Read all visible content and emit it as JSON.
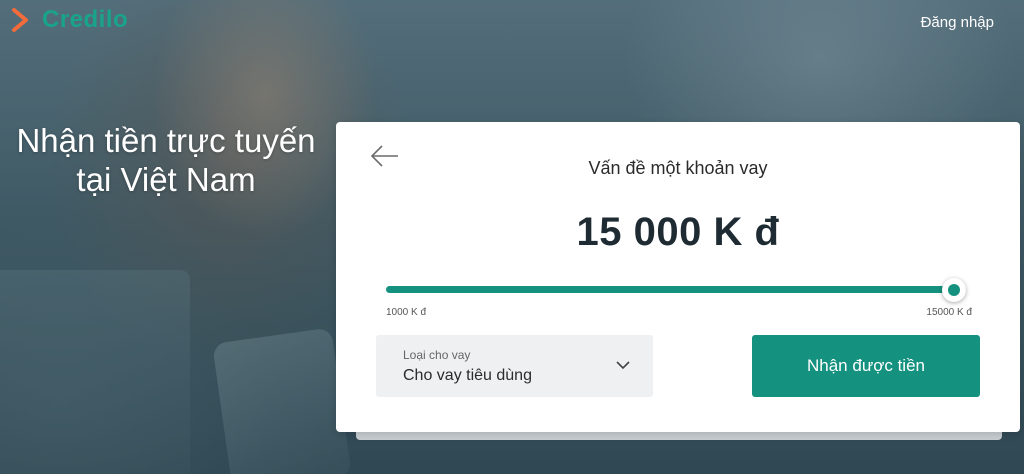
{
  "brand": {
    "name": "Credilo",
    "accent": "#1aa38c",
    "chevron_color": "#f26b3a",
    "button_color": "#15917f"
  },
  "header": {
    "login_label": "Đăng nhập"
  },
  "hero": {
    "title_line1": "Nhận tiền trực tuyến",
    "title_line2": "tại Việt Nam"
  },
  "card": {
    "back_icon": "arrow-left-icon",
    "title": "Vấn đề một khoản vay",
    "amount": "15 000 K đ",
    "slider": {
      "min_label": "1000 K đ",
      "max_label": "15000 K đ",
      "min": 1000,
      "max": 15000,
      "value": 15000
    },
    "loan_type": {
      "label": "Loại cho vay",
      "value": "Cho vay tiêu dùng",
      "icon": "chevron-down-icon"
    },
    "cta_label": "Nhận được tiền"
  }
}
